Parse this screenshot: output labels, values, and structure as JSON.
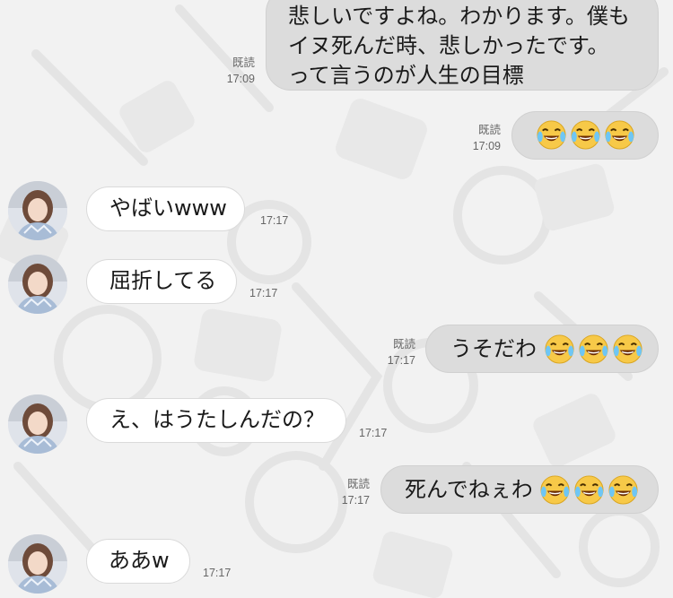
{
  "messages": [
    {
      "id": "m1",
      "direction": "out",
      "lines": [
        "悲しいですよね。わかります。僕も",
        "イヌ死んだ時、悲しかったです。",
        "って言うのが人生の目標"
      ],
      "read": "既読",
      "time": "17:09"
    },
    {
      "id": "m2",
      "direction": "out",
      "text": "",
      "emoji_count": 3,
      "emoji": "face-with-tears-of-joy",
      "read": "既読",
      "time": "17:09"
    },
    {
      "id": "m3",
      "direction": "in",
      "text": "やばいwww",
      "time": "17:17"
    },
    {
      "id": "m4",
      "direction": "in",
      "text": "屈折してる",
      "time": "17:17"
    },
    {
      "id": "m5",
      "direction": "out",
      "text": "うそだわ",
      "emoji_count": 3,
      "emoji": "face-with-tears-of-joy",
      "read": "既読",
      "time": "17:17"
    },
    {
      "id": "m6",
      "direction": "in",
      "text": "え、はうたしんだの？",
      "time": "17:17"
    },
    {
      "id": "m7",
      "direction": "out",
      "text": "死んでねぇわ",
      "emoji_count": 3,
      "emoji": "face-with-tears-of-joy",
      "read": "既読",
      "time": "17:17"
    },
    {
      "id": "m8",
      "direction": "in",
      "text": "ああw",
      "time": "17:17"
    }
  ],
  "colors": {
    "background": "#f2f2f2",
    "outgoing_bubble": "#dcdcdc",
    "incoming_bubble": "#ffffff",
    "meta_text": "#666666"
  }
}
